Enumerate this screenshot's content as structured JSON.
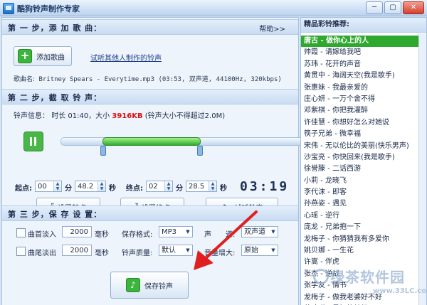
{
  "window": {
    "title": "酷狗铃声制作专家",
    "min": "─",
    "max": "▢",
    "close": "✕"
  },
  "step1": {
    "title": "第 一 步，添 加 歌 曲：",
    "help": "帮助>>",
    "add_song": "添加歌曲",
    "listen_link": "试听其他人制作的铃声",
    "song_name_label": "歌曲名:",
    "song_name_value": "Britney Spears - Everytime.mp3",
    "song_meta": "(03:53, 双声道, 44100Hz, 320kbps)"
  },
  "step2": {
    "title": "第 二 步，截 取 铃 声：",
    "info_label": "铃声信息：",
    "info_text": "时长 01:40，大小",
    "info_size": "3916KB",
    "info_note": "(铃声大小不得超过2.0M)",
    "selection_start_pct": 17,
    "selection_end_pct": 56,
    "start_label": "起点:",
    "start_min": "00",
    "min_unit": "分",
    "start_sec": "48.2",
    "sec_unit": "秒",
    "end_label": "终点:",
    "end_min": "02",
    "end_sec": "28.5",
    "timer": "03:19",
    "set_start": "设置起点",
    "set_end": "设置终点",
    "try_listen": "试听铃声"
  },
  "step3": {
    "title": "第 三 步，保 存 设 置：",
    "fade_in": "曲首淡入",
    "fade_in_ms": "2000",
    "fade_out": "曲尾淡出",
    "fade_out_ms": "2000",
    "ms_unit": "毫秒",
    "format_label": "保存格式:",
    "format_value": "MP3",
    "channel_label": "声　　道:",
    "channel_value": "双声道",
    "quality_label": "铃声质量:",
    "quality_value": "默认",
    "volume_label": "音量增大:",
    "volume_value": "原始",
    "save": "保存铃声"
  },
  "right": {
    "title": "精品彩铃推荐:",
    "items": [
      "唐古 - 做你心上的人",
      "帅霞 - 请嫁给我吧",
      "苏玮 - 花开的声音",
      "黄贯中 - 海阔天空(我是歌手)",
      "张惠妹 - 我最亲爱的",
      "庄心妍 - 一万个舍不得",
      "邓紫棋 - 你把我灌醉",
      "许佳慧 - 你想好怎么对她说",
      "筷子兄弟 - 微幸福",
      "宋伟 - 无以伦比的美丽(快乐男声)",
      "沙宝亮 - 你快回来(我是歌手)",
      "徐誉滕 - 二话西游",
      "小莉 - 龙晓飞",
      "李代沫 - 即客",
      "孙燕姿 - 遇见",
      "心瑶 - 逆行",
      "庞龙 - 兄弟抱一下",
      "龙梅子 - 你猜猜我有多爱你",
      "姚贝娜 - 一生花",
      "许嵩 - 伴虎",
      "张杰 - 逆战",
      "张学友 - 情书",
      "龙梅子 - 做我老婆好不好",
      "范玮琪 - 最初的梦想"
    ],
    "selected_index": 0
  },
  "watermark": {
    "text": "绿茶软件园",
    "url": "www.33LC.com"
  },
  "colors": {
    "accent_green": "#2fa82f",
    "size_red": "#dd1111",
    "arrow_red": "#e02020"
  }
}
